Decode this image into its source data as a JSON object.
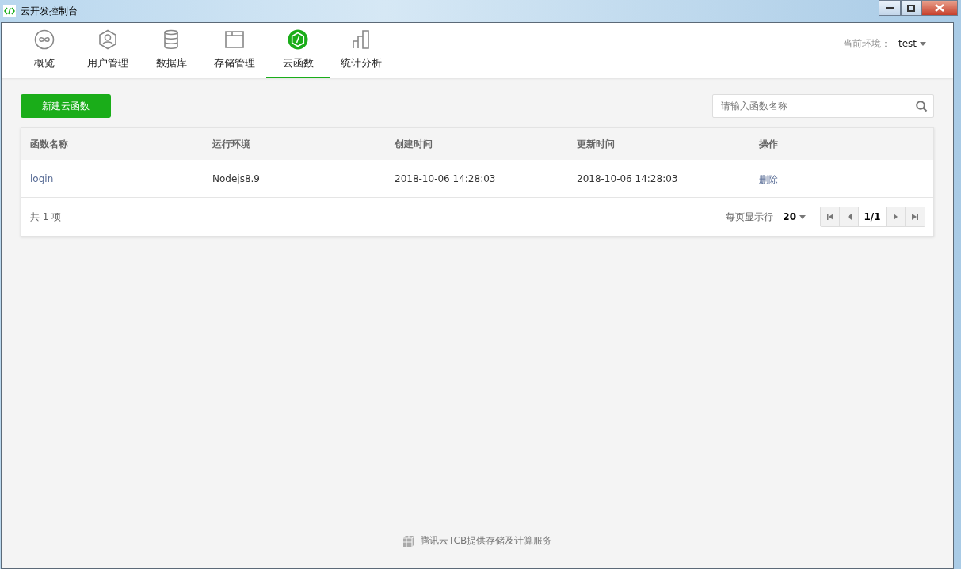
{
  "window": {
    "title": "云开发控制台"
  },
  "tabs": [
    {
      "label": "概览",
      "selected": false
    },
    {
      "label": "用户管理",
      "selected": false
    },
    {
      "label": "数据库",
      "selected": false
    },
    {
      "label": "存储管理",
      "selected": false
    },
    {
      "label": "云函数",
      "selected": true
    },
    {
      "label": "统计分析",
      "selected": false
    }
  ],
  "environment": {
    "label": "当前环境：",
    "value": "test"
  },
  "create_button": "新建云函数",
  "search": {
    "placeholder": "请输入函数名称"
  },
  "table": {
    "columns": [
      "函数名称",
      "运行环境",
      "创建时间",
      "更新时间",
      "操作"
    ],
    "rows": [
      {
        "name": "login",
        "runtime": "Nodejs8.9",
        "created": "2018-10-06 14:28:03",
        "updated": "2018-10-06 14:28:03",
        "action": "删除"
      }
    ]
  },
  "footer": {
    "total": "共 1 项",
    "page_size_label": "每页显示行",
    "page_size": "20",
    "page": "1/1"
  },
  "credit": "腾讯云TCB提供存储及计算服务"
}
